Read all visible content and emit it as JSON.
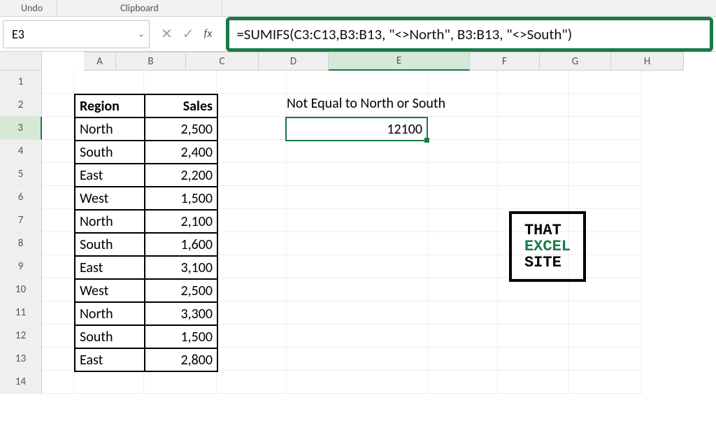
{
  "ribbon": {
    "undo": "Undo",
    "clipboard": "Clipboard"
  },
  "name_box": {
    "value": "E3"
  },
  "formula_bar": {
    "fx": "fx",
    "formula": "=SUMIFS(C3:C13,B3:B13, \"<>North\", B3:B13, \"<>South\")"
  },
  "columns": [
    "A",
    "B",
    "C",
    "D",
    "E",
    "F",
    "G",
    "H"
  ],
  "rows": [
    "1",
    "2",
    "3",
    "4",
    "5",
    "6",
    "7",
    "8",
    "9",
    "10",
    "11",
    "12",
    "13",
    "14"
  ],
  "selected_col": "E",
  "selected_row": "3",
  "table": {
    "headers": {
      "region": "Region",
      "sales": "Sales"
    },
    "rows": [
      {
        "region": "North",
        "sales": "2,500"
      },
      {
        "region": "South",
        "sales": "2,400"
      },
      {
        "region": "East",
        "sales": "2,200"
      },
      {
        "region": "West",
        "sales": "1,500"
      },
      {
        "region": "North",
        "sales": "2,100"
      },
      {
        "region": "South",
        "sales": "1,600"
      },
      {
        "region": "East",
        "sales": "3,100"
      },
      {
        "region": "West",
        "sales": "2,500"
      },
      {
        "region": "North",
        "sales": "3,300"
      },
      {
        "region": "South",
        "sales": "1,500"
      },
      {
        "region": "East",
        "sales": "2,800"
      }
    ]
  },
  "labels": {
    "note": "Not Equal to North or South",
    "result": "12100"
  },
  "logo": {
    "line1": "THAT",
    "line2": "EXCEL",
    "line3": "SITE"
  },
  "glyphs": {
    "x": "✕",
    "check": "✓",
    "chevron": "⌄"
  }
}
